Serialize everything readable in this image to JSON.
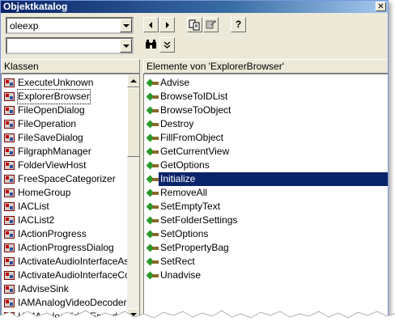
{
  "window": {
    "title": "Objektkatalog",
    "close_glyph": "✕"
  },
  "toolbar": {
    "library_combo_value": "oleexp",
    "search_combo_value": "",
    "back_icon": "back-arrow-icon",
    "forward_icon": "forward-arrow-icon",
    "copy_icon": "copy-to-clipboard-icon",
    "view_definition_icon": "view-definition-icon",
    "help_glyph": "?",
    "search_glyph": "🔍",
    "toggle_glyph": "⌄"
  },
  "classes": {
    "header": "Klassen",
    "items": [
      "ExecuteUnknown",
      "ExplorerBrowser",
      "FileOpenDialog",
      "FileOperation",
      "FileSaveDialog",
      "FilgraphManager",
      "FolderViewHost",
      "FreeSpaceCategorizer",
      "HomeGroup",
      "IACList",
      "IACList2",
      "IActionProgress",
      "IActionProgressDialog",
      "IActivateAudioInterfaceAs",
      "IActivateAudioInterfaceCo",
      "IAdviseSink",
      "IAMAnalogVideoDecoder",
      "IAMAnalogVideoEncoder"
    ],
    "focused_index": 1
  },
  "members": {
    "header": "Elemente von 'ExplorerBrowser'",
    "items": [
      "Advise",
      "BrowseToIDList",
      "BrowseToObject",
      "Destroy",
      "FillFromObject",
      "GetCurrentView",
      "GetOptions",
      "Initialize",
      "RemoveAll",
      "SetEmptyText",
      "SetFolderSettings",
      "SetOptions",
      "SetPropertyBag",
      "SetRect",
      "Unadvise"
    ],
    "selected_index": 7
  },
  "colors": {
    "selection": "#0a246a",
    "window_bg": "#ece9d8",
    "title_start": "#0a246a"
  }
}
